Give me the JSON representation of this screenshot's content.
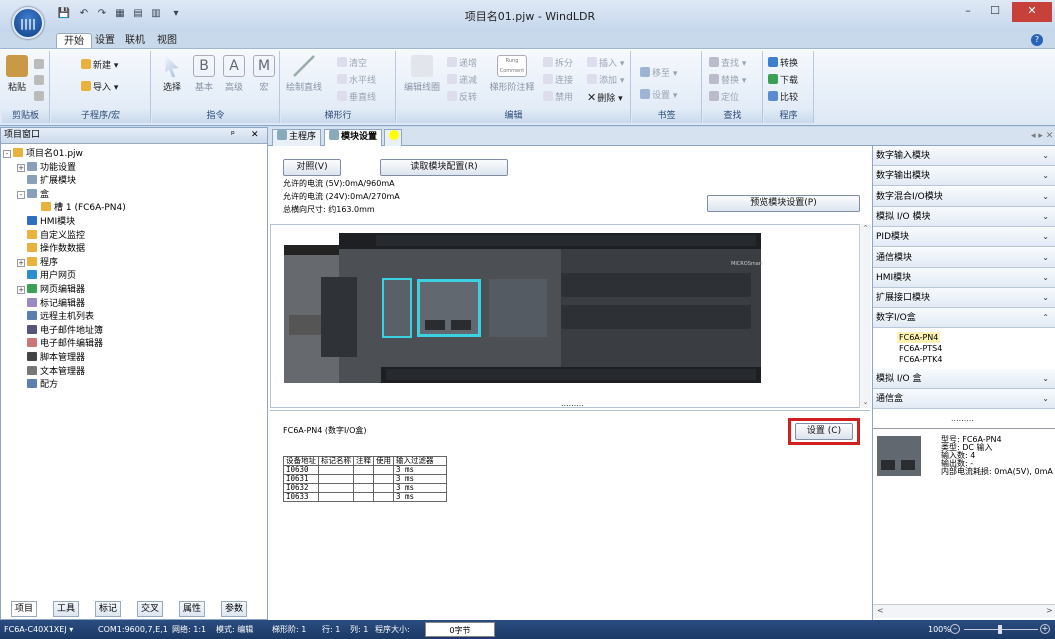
{
  "window": {
    "title": "项目名01.pjw - WindLDR",
    "minimize": "–",
    "maximize": "☐",
    "close": "✕"
  },
  "quick_access": [
    "💾",
    "↶",
    "↷",
    "▦",
    "▤",
    "▥",
    "▾"
  ],
  "menu_tabs": [
    "开始",
    "设置",
    "联机",
    "视图"
  ],
  "ribbon": {
    "clipboard": {
      "label": "剪贴板",
      "paste": "粘贴"
    },
    "program": {
      "label": "子程序/宏",
      "new": "新建 ▾",
      "import": "导入 ▾"
    },
    "instruction": {
      "label": "指令",
      "select": "选择",
      "basic": "基本",
      "advanced": "高级",
      "macro": "宏",
      "basic_icon": "B",
      "advanced_icon": "A",
      "macro_icon": "M"
    },
    "ladder": {
      "label": "梯形行",
      "draw_line": "绘制直线",
      "clear": "清空",
      "hline": "水平线",
      "vline": "垂直线"
    },
    "edit": {
      "label": "编辑",
      "edit_lines": "编辑线圈",
      "increase": "递增",
      "decrease": "递减",
      "reverse": "反转",
      "comment": "梯形阶注释",
      "split": "拆分",
      "connect": "连接",
      "disable": "禁用",
      "insert": "插入 ▾",
      "add": "添加 ▾",
      "delete": "删除 ▾",
      "comment_icon": "Rung Comment"
    },
    "bookmark": {
      "label": "书签",
      "move": "移至 ▾",
      "set": "设置 ▾"
    },
    "find": {
      "label": "查找",
      "find": "查找 ▾",
      "replace": "替换 ▾",
      "locate": "定位"
    },
    "program2": {
      "label": "程序",
      "convert": "转换",
      "download": "下载",
      "compare": "比较"
    }
  },
  "left_panel": {
    "title": "项目窗口",
    "pin": "ᵖ",
    "close": "✕",
    "tree": [
      {
        "label": "项目名01.pjw",
        "icon": "folder-icon",
        "color": "#e8b23c"
      },
      {
        "label": "功能设置",
        "icon": "settings-icon",
        "color": "#8aa0b8"
      },
      {
        "label": "扩展模块",
        "icon": "module-icon",
        "color": "#8aa0b8"
      },
      {
        "label": "盒",
        "icon": "box-icon",
        "color": "#8aa0b8"
      },
      {
        "label": "槽 1 (FC6A-PN4)",
        "icon": "folder-icon",
        "color": "#e8b23c"
      },
      {
        "label": "HMI模块",
        "icon": "hmi-icon",
        "color": "#2f6fc0"
      },
      {
        "label": "自定义监控",
        "icon": "folder-icon",
        "color": "#e8b23c"
      },
      {
        "label": "操作数数据",
        "icon": "folder-icon",
        "color": "#e8b23c"
      },
      {
        "label": "程序",
        "icon": "folder-icon",
        "color": "#e8b23c"
      },
      {
        "label": "用户网页",
        "icon": "globe-icon",
        "color": "#2a8fd0"
      },
      {
        "label": "网页编辑器",
        "icon": "web-editor-icon",
        "color": "#3aa055"
      },
      {
        "label": "标记编辑器",
        "icon": "tag-icon",
        "color": "#9b8ac0"
      },
      {
        "label": "远程主机列表",
        "icon": "host-icon",
        "color": "#5a7fae"
      },
      {
        "label": "电子邮件地址簿",
        "icon": "addressbook-icon",
        "color": "#557"
      },
      {
        "label": "电子邮件编辑器",
        "icon": "email-icon",
        "color": "#c77"
      },
      {
        "label": "脚本管理器",
        "icon": "script-icon",
        "color": "#444"
      },
      {
        "label": "文本管理器",
        "icon": "text-icon",
        "color": "#777"
      },
      {
        "label": "配方",
        "icon": "recipe-icon",
        "color": "#5a7fae"
      }
    ],
    "bottom_tabs": [
      "项目",
      "工具",
      "标记",
      "交叉",
      "属性",
      "参数"
    ]
  },
  "doc_tabs": [
    "主程序",
    "模块设置"
  ],
  "module_settings": {
    "reference_btn": "对照(V)",
    "read_config_btn": "读取模块配置(R)",
    "preview_btn": "预览模块设置(P)",
    "current_5v": "允许的电流 (5V):0mA/960mA",
    "current_24v": "允许的电流 (24V):0mA/270mA",
    "total_width": "总横向尺寸: 约163.0mm",
    "brand_label": "MICROSmart",
    "selected_module": "FC6A-PN4 (数字I/O盒)",
    "settings_btn": "设置 (C)",
    "table": {
      "headers": [
        "设备地址",
        "标记名称",
        "注释",
        "使用",
        "输入过滤器"
      ],
      "rows": [
        [
          "I0630",
          "",
          "",
          "",
          "3 ms"
        ],
        [
          "I0631",
          "",
          "",
          "",
          "3 ms"
        ],
        [
          "I0632",
          "",
          "",
          "",
          "3 ms"
        ],
        [
          "I0633",
          "",
          "",
          "",
          "3 ms"
        ]
      ]
    }
  },
  "right_panel": {
    "categories": [
      "数字输入模块",
      "数字输出模块",
      "数字混合I/O模块",
      "模拟 I/O 模块",
      "PID模块",
      "通信模块",
      "HMI模块",
      "扩展接口模块",
      "数字I/O盒"
    ],
    "expanded_items": [
      "FC6A-PN4",
      "FC6A-PTS4",
      "FC6A-PTK4"
    ],
    "categories2": [
      "模拟 I/O 盒",
      "通信盒"
    ],
    "info": {
      "model": "型号: FC6A-PN4",
      "type": "类型: DC 输入",
      "inputs": "输入数: 4",
      "outputs": "输出数: -",
      "current": "内部电流耗损: 0mA(5V), 0mA"
    }
  },
  "status": {
    "plc": "FC6A-C40X1XEJ ▾",
    "com": "COM1:9600,7,E,1",
    "network": "网络: 1:1",
    "mode": "模式: 编辑",
    "rung": "梯形阶: 1",
    "row": "行: 1",
    "col": "列: 1",
    "size_label": "程序大小:",
    "size": "0字节",
    "zoom": "100%"
  },
  "colors": {
    "accent": "#1c3a66",
    "highlight_red": "#d21f1f",
    "module_cyan": "#3ad1e0"
  }
}
